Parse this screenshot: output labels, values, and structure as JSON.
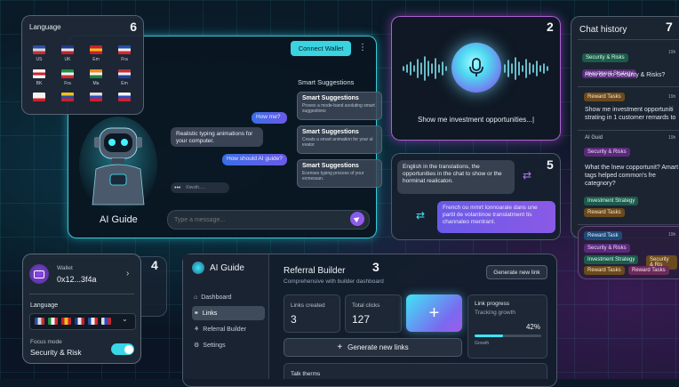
{
  "language_panel": {
    "title": "Language",
    "number": "6",
    "flags": [
      {
        "label": "US",
        "c1": "#2b4fa6",
        "c2": "#d8d8d8",
        "c3": "#c0303a"
      },
      {
        "label": "UK",
        "c1": "#1d3c8f",
        "c2": "#e8e8e8",
        "c3": "#c8202e"
      },
      {
        "label": "Em",
        "c1": "#c8202e",
        "c2": "#f0c020",
        "c3": "#c8202e"
      },
      {
        "label": "Fra",
        "c1": "#2050a8",
        "c2": "#f0f0f0",
        "c3": "#d02a34"
      },
      {
        "label": "BK",
        "c1": "#f4f4f4",
        "c2": "#d0202a",
        "c3": "#f4f4f4"
      },
      {
        "label": "Fra",
        "c1": "#1e9040",
        "c2": "#f4f4f4",
        "c3": "#d02a34"
      },
      {
        "label": "Ma",
        "c1": "#f08a20",
        "c2": "#f4f4f4",
        "c3": "#1e8040"
      },
      {
        "label": "Em",
        "c1": "#c0303a",
        "c2": "#f0f0f0",
        "c3": "#2040a0"
      },
      {
        "label": "",
        "c1": "#f4f4f4",
        "c2": "#f4f4f4",
        "c3": "#d0202a"
      },
      {
        "label": "",
        "c1": "#f0c020",
        "c2": "#2050a8",
        "c3": "#c8202e"
      },
      {
        "label": "",
        "c1": "#e0e0e0",
        "c2": "#2a4cc0",
        "c3": "#d0202a"
      },
      {
        "label": "",
        "c1": "#f4f4f4",
        "c2": "#2a4cc0",
        "c3": "#d0202a"
      }
    ]
  },
  "chat_panel": {
    "connect_wallet": "Connect Wallet",
    "more": "⋮",
    "suggestions_title": "Smart Suggestions",
    "suggestions": [
      {
        "title": "Smart Suggestions",
        "desc": "Proves a mode-band avoluting smart suggestions"
      },
      {
        "title": "Smart Suggestions",
        "desc": "Creats a smart animation for your ul evator"
      },
      {
        "title": "Smart Suggestions",
        "desc": "Ecenses typing process of your ecmessan."
      }
    ],
    "messages": [
      {
        "text": "How me?",
        "from": "user"
      },
      {
        "text": "Realistic typing animations for your computer.",
        "from": "bot"
      },
      {
        "text": "How should AI guide?",
        "from": "user"
      }
    ],
    "typing_dots": "•••",
    "typing_label": "Kiwsth.....",
    "bot_name": "AI Guide",
    "input_placeholder": "Type a message..."
  },
  "voice_panel": {
    "number": "2",
    "transcript": "Show me investment opportunities...|"
  },
  "translation_panel": {
    "number": "5",
    "source_text": "English in the translations, the opportunities in the chat to show or the horminat realicaton.",
    "translated_text": "French ou mmrt lonnoarale dans une partil de volantinoe translatment tis channaleo mentrant."
  },
  "chat_history": {
    "title": "Chat history",
    "number": "7",
    "entries": [
      {
        "tags": [
          "Security & Risks",
          "Investment Strategy"
        ],
        "time": "19h",
        "question": "How do on Security & Risks?"
      },
      {
        "tags": [
          "Reward Tasks"
        ],
        "time": "19h",
        "question": "Show me investment opportuniti strating in 1 customer remards to"
      },
      {
        "tags": [
          "AI Guid",
          "Security & Risks"
        ],
        "time": "19h",
        "question": "What the lnew copportunit? Amart tags helped common's fre categnory?",
        "extra_tags": [
          "Investment Strategy",
          "Reward Tasks"
        ]
      },
      {
        "tags": [
          "Reward Task",
          "Security & Risks",
          "Investment Strategy",
          "Security & Ris",
          "Reward Tasks",
          "Reward Tasks"
        ],
        "time": "19h",
        "question": ""
      }
    ]
  },
  "wallet_panel": {
    "number": "4",
    "wallet_label": "Wallet",
    "address": "0x12...3f4a",
    "language_label": "Language",
    "focus_label": "Focus mode",
    "focus_value": "Security & Risk",
    "toggle_on": true
  },
  "dashboard": {
    "number": "3",
    "brand": "AI Guide",
    "nav": [
      {
        "label": "Dashboard",
        "icon": "⌂"
      },
      {
        "label": "Links",
        "icon": "⚭"
      },
      {
        "label": "Referral Builder",
        "icon": "⚘"
      },
      {
        "label": "Settings",
        "icon": "⚙"
      }
    ],
    "title": "Referral Builder",
    "subtitle": "Comprehensive with builder dashboard",
    "generate_new_link": "Generate new link",
    "links_created_label": "Links created",
    "links_created_value": "3",
    "total_clicks_label": "Total clicks",
    "total_clicks_value": "127",
    "plus": "+",
    "link_progress_label": "Link progress",
    "tracking_growth": "Tracking growth",
    "progress_percent": "42%",
    "progress_value": 0.42,
    "growth_label": "Growth",
    "generate_new_links": "Generate new links",
    "talk_terms": "Talk therms"
  }
}
